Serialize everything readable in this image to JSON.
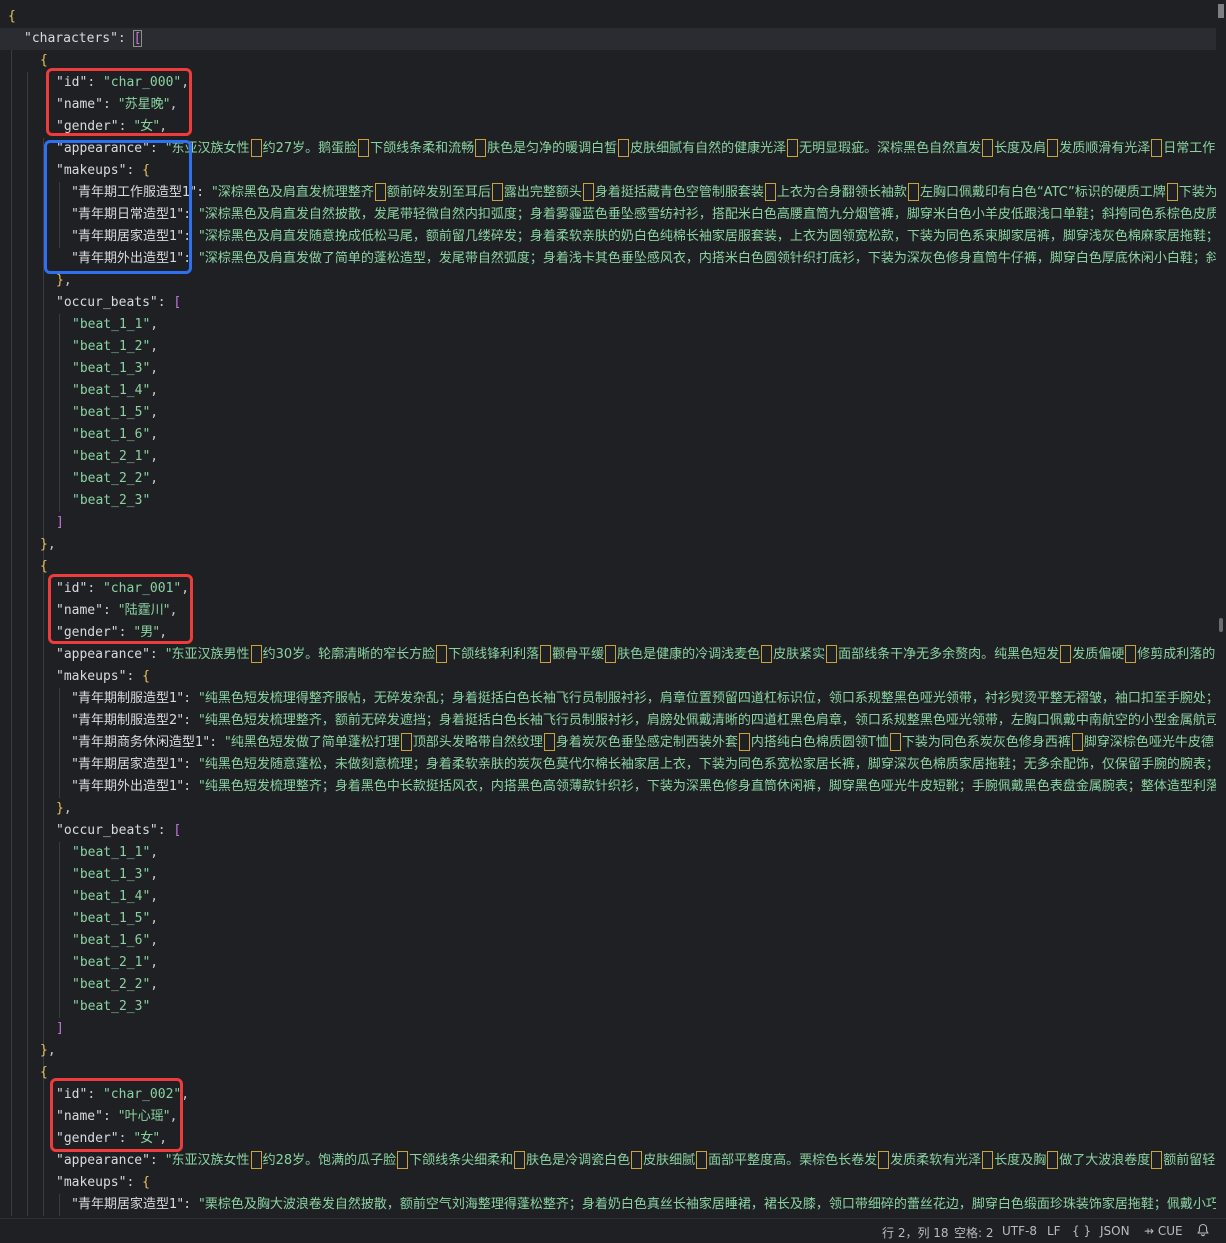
{
  "editor": {
    "lines": [
      {
        "indent": 0,
        "tokens": [
          [
            "{",
            "brace"
          ]
        ]
      },
      {
        "indent": 1,
        "tokens": [
          [
            "\"characters\"",
            "key"
          ],
          [
            ": ",
            "punc"
          ],
          [
            "[",
            "bracket-act"
          ]
        ]
      },
      {
        "indent": 2,
        "tokens": [
          [
            "{",
            "brace"
          ]
        ]
      },
      {
        "indent": 3,
        "tokens": [
          [
            "\"id\"",
            "key"
          ],
          [
            ": ",
            "punc"
          ],
          [
            "\"char_000\"",
            "str"
          ],
          [
            ",",
            "punc"
          ]
        ]
      },
      {
        "indent": 3,
        "tokens": [
          [
            "\"name\"",
            "key"
          ],
          [
            ": ",
            "punc"
          ],
          [
            "\"苏星晚\"",
            "str"
          ],
          [
            ",",
            "punc"
          ]
        ]
      },
      {
        "indent": 3,
        "tokens": [
          [
            "\"gender\"",
            "key"
          ],
          [
            ": ",
            "punc"
          ],
          [
            "\"女\"",
            "str"
          ],
          [
            ",",
            "punc"
          ]
        ]
      },
      {
        "indent": 3,
        "tokens": [
          [
            "\"appearance\"",
            "key"
          ],
          [
            ": ",
            "punc"
          ],
          [
            "\"东亚汉族女性",
            "str"
          ],
          [
            "|",
            "mark"
          ],
          [
            "约27岁。鹅蛋脸",
            "str"
          ],
          [
            "|",
            "mark"
          ],
          [
            "下颌线条柔和流畅",
            "str"
          ],
          [
            "|",
            "mark"
          ],
          [
            "肤色是匀净的暖调白皙",
            "str"
          ],
          [
            "|",
            "mark"
          ],
          [
            "皮肤细腻有自然的健康光泽",
            "str"
          ],
          [
            "|",
            "mark"
          ],
          [
            "无明显瑕疵。深棕黑色自然直发",
            "str"
          ],
          [
            "|",
            "mark"
          ],
          [
            "长度及肩",
            "str"
          ],
          [
            "|",
            "mark"
          ],
          [
            "发质顺滑有光泽",
            "str"
          ],
          [
            "|",
            "mark"
          ],
          [
            "日常工作时",
            "str"
          ]
        ]
      },
      {
        "indent": 3,
        "tokens": [
          [
            "\"makeups\"",
            "key"
          ],
          [
            ": ",
            "punc"
          ],
          [
            "{",
            "brace"
          ]
        ]
      },
      {
        "indent": 4,
        "tokens": [
          [
            "\"青年期工作服造型1\"",
            "key"
          ],
          [
            ": ",
            "punc"
          ],
          [
            "\"深棕黑色及肩直发梳理整齐",
            "str"
          ],
          [
            "|",
            "mark"
          ],
          [
            "额前碎发别至耳后",
            "str"
          ],
          [
            "|",
            "mark"
          ],
          [
            "露出完整额头",
            "str"
          ],
          [
            "|",
            "mark"
          ],
          [
            "身着挺括藏青色空管制服套装",
            "str"
          ],
          [
            "|",
            "mark"
          ],
          [
            "上衣为合身翻领长袖款",
            "str"
          ],
          [
            "|",
            "mark"
          ],
          [
            "左胸口佩戴印有白色“ATC”标识的硬质工牌",
            "str"
          ],
          [
            "|",
            "mark"
          ],
          [
            "下装为",
            "str"
          ]
        ]
      },
      {
        "indent": 4,
        "tokens": [
          [
            "\"青年期日常造型1\"",
            "key"
          ],
          [
            ": ",
            "punc"
          ],
          [
            "\"深棕黑色及肩直发自然披散，发尾带轻微自然内扣弧度；身着雾霾蓝色垂坠感雪纺衬衫，搭配米白色高腰直筒九分烟管裤，脚穿米白色小羊皮低跟浅口单鞋；斜挎同色系棕色皮质",
            "str"
          ]
        ]
      },
      {
        "indent": 4,
        "tokens": [
          [
            "\"青年期居家造型1\"",
            "key"
          ],
          [
            ": ",
            "punc"
          ],
          [
            "\"深棕黑色及肩直发随意挽成低松马尾，额前留几缕碎发；身着柔软亲肤的奶白色纯棉长袖家居服套装，上衣为圆领宽松款，下装为同色系束脚家居裤，脚穿浅灰色棉麻家居拖鞋；",
            "str"
          ]
        ]
      },
      {
        "indent": 4,
        "tokens": [
          [
            "\"青年期外出造型1\"",
            "key"
          ],
          [
            ": ",
            "punc"
          ],
          [
            "\"深棕黑色及肩直发做了简单的蓬松造型，发尾带自然弧度；身着浅卡其色垂坠感风衣，内搭米白色圆领针织打底衫，下装为深灰色修身直筒牛仔裤，脚穿白色厚底休闲小白鞋；斜",
            "str"
          ]
        ]
      },
      {
        "indent": 3,
        "tokens": [
          [
            "}",
            "brace"
          ],
          [
            ",",
            "punc"
          ]
        ]
      },
      {
        "indent": 3,
        "tokens": [
          [
            "\"occur_beats\"",
            "key"
          ],
          [
            ": ",
            "punc"
          ],
          [
            "[",
            "bracket"
          ]
        ]
      },
      {
        "indent": 4,
        "tokens": [
          [
            "\"beat_1_1\"",
            "str"
          ],
          [
            ",",
            "punc"
          ]
        ]
      },
      {
        "indent": 4,
        "tokens": [
          [
            "\"beat_1_2\"",
            "str"
          ],
          [
            ",",
            "punc"
          ]
        ]
      },
      {
        "indent": 4,
        "tokens": [
          [
            "\"beat_1_3\"",
            "str"
          ],
          [
            ",",
            "punc"
          ]
        ]
      },
      {
        "indent": 4,
        "tokens": [
          [
            "\"beat_1_4\"",
            "str"
          ],
          [
            ",",
            "punc"
          ]
        ]
      },
      {
        "indent": 4,
        "tokens": [
          [
            "\"beat_1_5\"",
            "str"
          ],
          [
            ",",
            "punc"
          ]
        ]
      },
      {
        "indent": 4,
        "tokens": [
          [
            "\"beat_1_6\"",
            "str"
          ],
          [
            ",",
            "punc"
          ]
        ]
      },
      {
        "indent": 4,
        "tokens": [
          [
            "\"beat_2_1\"",
            "str"
          ],
          [
            ",",
            "punc"
          ]
        ]
      },
      {
        "indent": 4,
        "tokens": [
          [
            "\"beat_2_2\"",
            "str"
          ],
          [
            ",",
            "punc"
          ]
        ]
      },
      {
        "indent": 4,
        "tokens": [
          [
            "\"beat_2_3\"",
            "str"
          ]
        ]
      },
      {
        "indent": 3,
        "tokens": [
          [
            "]",
            "bracket"
          ]
        ]
      },
      {
        "indent": 2,
        "tokens": [
          [
            "}",
            "brace"
          ],
          [
            ",",
            "punc"
          ]
        ]
      },
      {
        "indent": 2,
        "tokens": [
          [
            "{",
            "brace"
          ]
        ]
      },
      {
        "indent": 3,
        "tokens": [
          [
            "\"id\"",
            "key"
          ],
          [
            ": ",
            "punc"
          ],
          [
            "\"char_001\"",
            "str"
          ],
          [
            ",",
            "punc"
          ]
        ]
      },
      {
        "indent": 3,
        "tokens": [
          [
            "\"name\"",
            "key"
          ],
          [
            ": ",
            "punc"
          ],
          [
            "\"陆霆川\"",
            "str"
          ],
          [
            ",",
            "punc"
          ]
        ]
      },
      {
        "indent": 3,
        "tokens": [
          [
            "\"gender\"",
            "key"
          ],
          [
            ": ",
            "punc"
          ],
          [
            "\"男\"",
            "str"
          ],
          [
            ",",
            "punc"
          ]
        ]
      },
      {
        "indent": 3,
        "tokens": [
          [
            "\"appearance\"",
            "key"
          ],
          [
            ": ",
            "punc"
          ],
          [
            "\"东亚汉族男性",
            "str"
          ],
          [
            "|",
            "mark"
          ],
          [
            "约30岁。轮廓清晰的窄长方脸",
            "str"
          ],
          [
            "|",
            "mark"
          ],
          [
            "下颌线锋利利落",
            "str"
          ],
          [
            "|",
            "mark"
          ],
          [
            "颧骨平缓",
            "str"
          ],
          [
            "|",
            "mark"
          ],
          [
            "肤色是健康的冷调浅麦色",
            "str"
          ],
          [
            "|",
            "mark"
          ],
          [
            "皮肤紧实",
            "str"
          ],
          [
            "|",
            "mark"
          ],
          [
            "面部线条干净无多余赘肉。纯黑色短发",
            "str"
          ],
          [
            "|",
            "mark"
          ],
          [
            "发质偏硬",
            "str"
          ],
          [
            "|",
            "mark"
          ],
          [
            "修剪成利落的",
            "str"
          ]
        ]
      },
      {
        "indent": 3,
        "tokens": [
          [
            "\"makeups\"",
            "key"
          ],
          [
            ": ",
            "punc"
          ],
          [
            "{",
            "brace"
          ]
        ]
      },
      {
        "indent": 4,
        "tokens": [
          [
            "\"青年期制服造型1\"",
            "key"
          ],
          [
            ": ",
            "punc"
          ],
          [
            "\"纯黑色短发梳理得整齐服帖，无碎发杂乱；身着挺括白色长袖飞行员制服衬衫，肩章位置预留四道杠标识位，领口系规整黑色哑光领带，衬衫熨烫平整无褶皱，袖口扣至手腕处；",
            "str"
          ]
        ]
      },
      {
        "indent": 4,
        "tokens": [
          [
            "\"青年期制服造型2\"",
            "key"
          ],
          [
            ": ",
            "punc"
          ],
          [
            "\"纯黑色短发梳理整齐，额前无碎发遮挡；身着挺括白色长袖飞行员制服衬衫，肩膀处佩戴清晰的四道杠黑色肩章，领口系规整黑色哑光领带，左胸口佩戴中南航空的小型金属航司",
            "str"
          ]
        ]
      },
      {
        "indent": 4,
        "tokens": [
          [
            "\"青年期商务休闲造型1\"",
            "key"
          ],
          [
            ": ",
            "punc"
          ],
          [
            "\"纯黑色短发做了简单蓬松打理",
            "str"
          ],
          [
            "|",
            "mark"
          ],
          [
            "顶部头发略带自然纹理",
            "str"
          ],
          [
            "|",
            "mark"
          ],
          [
            "身着炭灰色垂坠感定制西装外套",
            "str"
          ],
          [
            "|",
            "mark"
          ],
          [
            "内搭纯白色棉质圆领T恤",
            "str"
          ],
          [
            "|",
            "mark"
          ],
          [
            "下装为同色系炭灰色修身西裤",
            "str"
          ],
          [
            "|",
            "mark"
          ],
          [
            "脚穿深棕色哑光牛皮德",
            "str"
          ]
        ]
      },
      {
        "indent": 4,
        "tokens": [
          [
            "\"青年期居家造型1\"",
            "key"
          ],
          [
            ": ",
            "punc"
          ],
          [
            "\"纯黑色短发随意蓬松，未做刻意梳理；身着柔软亲肤的炭灰色莫代尔棉长袖家居上衣，下装为同色系宽松家居长裤，脚穿深灰色棉质家居拖鞋；无多余配饰，仅保留手腕的腕表；",
            "str"
          ]
        ]
      },
      {
        "indent": 4,
        "tokens": [
          [
            "\"青年期外出造型1\"",
            "key"
          ],
          [
            ": ",
            "punc"
          ],
          [
            "\"纯黑色短发梳理整齐；身着黑色中长款挺括风衣，内搭黑色高领薄款针织衫，下装为深黑色修身直筒休闲裤，脚穿黑色哑光牛皮短靴；手腕佩戴黑色表盘金属腕表；整体造型利落",
            "str"
          ]
        ]
      },
      {
        "indent": 3,
        "tokens": [
          [
            "}",
            "brace"
          ],
          [
            ",",
            "punc"
          ]
        ]
      },
      {
        "indent": 3,
        "tokens": [
          [
            "\"occur_beats\"",
            "key"
          ],
          [
            ": ",
            "punc"
          ],
          [
            "[",
            "bracket"
          ]
        ]
      },
      {
        "indent": 4,
        "tokens": [
          [
            "\"beat_1_1\"",
            "str"
          ],
          [
            ",",
            "punc"
          ]
        ]
      },
      {
        "indent": 4,
        "tokens": [
          [
            "\"beat_1_3\"",
            "str"
          ],
          [
            ",",
            "punc"
          ]
        ]
      },
      {
        "indent": 4,
        "tokens": [
          [
            "\"beat_1_4\"",
            "str"
          ],
          [
            ",",
            "punc"
          ]
        ]
      },
      {
        "indent": 4,
        "tokens": [
          [
            "\"beat_1_5\"",
            "str"
          ],
          [
            ",",
            "punc"
          ]
        ]
      },
      {
        "indent": 4,
        "tokens": [
          [
            "\"beat_1_6\"",
            "str"
          ],
          [
            ",",
            "punc"
          ]
        ]
      },
      {
        "indent": 4,
        "tokens": [
          [
            "\"beat_2_1\"",
            "str"
          ],
          [
            ",",
            "punc"
          ]
        ]
      },
      {
        "indent": 4,
        "tokens": [
          [
            "\"beat_2_2\"",
            "str"
          ],
          [
            ",",
            "punc"
          ]
        ]
      },
      {
        "indent": 4,
        "tokens": [
          [
            "\"beat_2_3\"",
            "str"
          ]
        ]
      },
      {
        "indent": 3,
        "tokens": [
          [
            "]",
            "bracket"
          ]
        ]
      },
      {
        "indent": 2,
        "tokens": [
          [
            "}",
            "brace"
          ],
          [
            ",",
            "punc"
          ]
        ]
      },
      {
        "indent": 2,
        "tokens": [
          [
            "{",
            "brace"
          ]
        ]
      },
      {
        "indent": 3,
        "tokens": [
          [
            "\"id\"",
            "key"
          ],
          [
            ": ",
            "punc"
          ],
          [
            "\"char_002\"",
            "str"
          ],
          [
            ",",
            "punc"
          ]
        ]
      },
      {
        "indent": 3,
        "tokens": [
          [
            "\"name\"",
            "key"
          ],
          [
            ": ",
            "punc"
          ],
          [
            "\"叶心瑶\"",
            "str"
          ],
          [
            ",",
            "punc"
          ]
        ]
      },
      {
        "indent": 3,
        "tokens": [
          [
            "\"gender\"",
            "key"
          ],
          [
            ": ",
            "punc"
          ],
          [
            "\"女\"",
            "str"
          ],
          [
            ",",
            "punc"
          ]
        ]
      },
      {
        "indent": 3,
        "tokens": [
          [
            "\"appearance\"",
            "key"
          ],
          [
            ": ",
            "punc"
          ],
          [
            "\"东亚汉族女性",
            "str"
          ],
          [
            "|",
            "mark"
          ],
          [
            "约28岁。饱满的瓜子脸",
            "str"
          ],
          [
            "|",
            "mark"
          ],
          [
            "下颌线条尖细柔和",
            "str"
          ],
          [
            "|",
            "mark"
          ],
          [
            "肤色是冷调瓷白色",
            "str"
          ],
          [
            "|",
            "mark"
          ],
          [
            "皮肤细腻",
            "str"
          ],
          [
            "|",
            "mark"
          ],
          [
            "面部平整度高。栗棕色长卷发",
            "str"
          ],
          [
            "|",
            "mark"
          ],
          [
            "发质柔软有光泽",
            "str"
          ],
          [
            "|",
            "mark"
          ],
          [
            "长度及胸",
            "str"
          ],
          [
            "|",
            "mark"
          ],
          [
            "做了大波浪卷度",
            "str"
          ],
          [
            "|",
            "mark"
          ],
          [
            "额前留轻薄",
            "str"
          ]
        ]
      },
      {
        "indent": 3,
        "tokens": [
          [
            "\"makeups\"",
            "key"
          ],
          [
            ": ",
            "punc"
          ],
          [
            "{",
            "brace"
          ]
        ]
      },
      {
        "indent": 4,
        "tokens": [
          [
            "\"青年期居家造型1\"",
            "key"
          ],
          [
            ": ",
            "punc"
          ],
          [
            "\"栗棕色及胸大波浪卷发自然披散，额前空气刘海整理得蓬松整齐；身着奶白色真丝长袖家居睡裙，裙长及膝，领口带细碎的蕾丝花边，脚穿白色缎面珍珠装饰家居拖鞋；佩戴小巧",
            "str"
          ]
        ]
      }
    ]
  },
  "statusbar": {
    "cursor": "行 2，列 18",
    "indent": "空格: 2",
    "encoding": "UTF-8",
    "eol": "LF",
    "braces": "{ }",
    "language": "JSON",
    "cue": "CUE",
    "bell_icon": "bell-icon"
  }
}
